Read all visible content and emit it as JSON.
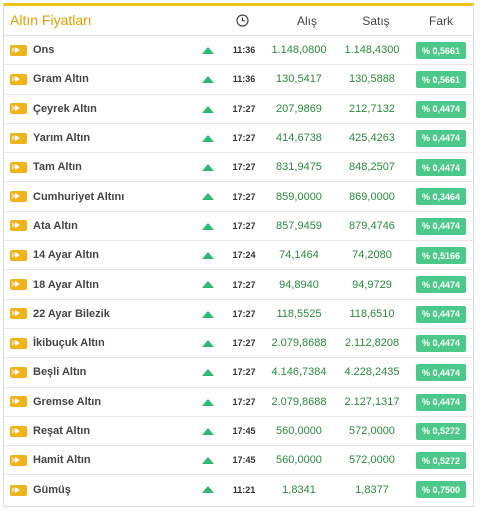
{
  "header": {
    "title": "Altın Fiyatları",
    "time_icon": "clock-icon",
    "buy_label": "Alış",
    "sell_label": "Satış",
    "change_label": "Fark"
  },
  "colors": {
    "accent": "#f0c419",
    "title": "#e0a100",
    "value_green": "#2b8a3e",
    "badge_green": "#4cc98a",
    "trend_up": "#2eb872"
  },
  "rows": [
    {
      "name": "Ons",
      "trend": "up",
      "time": "11:36",
      "buy": "1.148,0800",
      "sell": "1.148,4300",
      "change": "% 0,5661"
    },
    {
      "name": "Gram Altın",
      "trend": "up",
      "time": "11:36",
      "buy": "130,5417",
      "sell": "130,5888",
      "change": "% 0,5661"
    },
    {
      "name": "Çeyrek Altın",
      "trend": "up",
      "time": "17:27",
      "buy": "207,9869",
      "sell": "212,7132",
      "change": "% 0,4474"
    },
    {
      "name": "Yarım Altın",
      "trend": "up",
      "time": "17:27",
      "buy": "414,6738",
      "sell": "425,4263",
      "change": "% 0,4474"
    },
    {
      "name": "Tam Altın",
      "trend": "up",
      "time": "17:27",
      "buy": "831,9475",
      "sell": "848,2507",
      "change": "% 0,4474"
    },
    {
      "name": "Cumhuriyet Altını",
      "trend": "up",
      "time": "17:27",
      "buy": "859,0000",
      "sell": "869,0000",
      "change": "% 0,3464"
    },
    {
      "name": "Ata Altın",
      "trend": "up",
      "time": "17:27",
      "buy": "857,9459",
      "sell": "879,4746",
      "change": "% 0,4474"
    },
    {
      "name": "14 Ayar Altın",
      "trend": "up",
      "time": "17:24",
      "buy": "74,1464",
      "sell": "74,2080",
      "change": "% 0,5166"
    },
    {
      "name": "18 Ayar Altın",
      "trend": "up",
      "time": "17:27",
      "buy": "94,8940",
      "sell": "94,9729",
      "change": "% 0,4474"
    },
    {
      "name": "22 Ayar Bilezik",
      "trend": "up",
      "time": "17:27",
      "buy": "118,5525",
      "sell": "118,6510",
      "change": "% 0,4474"
    },
    {
      "name": "İkibuçuk Altın",
      "trend": "up",
      "time": "17:27",
      "buy": "2.079,8688",
      "sell": "2.112,8208",
      "change": "% 0,4474"
    },
    {
      "name": "Beşli Altın",
      "trend": "up",
      "time": "17:27",
      "buy": "4.146,7384",
      "sell": "4.228,2435",
      "change": "% 0,4474"
    },
    {
      "name": "Gremse Altın",
      "trend": "up",
      "time": "17:27",
      "buy": "2.079,8688",
      "sell": "2.127,1317",
      "change": "% 0,4474"
    },
    {
      "name": "Reşat Altın",
      "trend": "up",
      "time": "17:45",
      "buy": "560,0000",
      "sell": "572,0000",
      "change": "% 0,5272"
    },
    {
      "name": "Hamit Altın",
      "trend": "up",
      "time": "17:45",
      "buy": "560,0000",
      "sell": "572,0000",
      "change": "% 0,5272"
    },
    {
      "name": "Gümüş",
      "trend": "up",
      "time": "11:21",
      "buy": "1,8341",
      "sell": "1,8377",
      "change": "% 0,7500"
    }
  ]
}
